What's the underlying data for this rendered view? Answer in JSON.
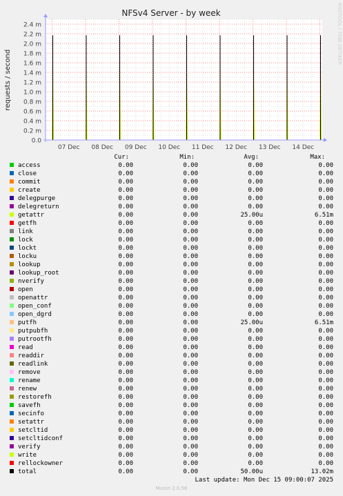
{
  "chart_data": {
    "type": "line",
    "title": "NFSv4 Server - by week",
    "ylabel": "requests / second",
    "xlabel": "",
    "ylim": [
      0,
      2.5
    ],
    "yticks": [
      "0.0",
      "0.2 m",
      "0.4 m",
      "0.6 m",
      "0.8 m",
      "1.0 m",
      "1.2 m",
      "1.4 m",
      "1.6 m",
      "1.8 m",
      "2.0 m",
      "2.2 m",
      "2.4 m"
    ],
    "xticks": [
      "07 Dec",
      "08 Dec",
      "09 Dec",
      "10 Dec",
      "11 Dec",
      "12 Dec",
      "13 Dec",
      "14 Dec"
    ],
    "grid": true,
    "series": [
      {
        "name": "total",
        "x": [
          "07 Dec",
          "08 Dec",
          "09 Dec",
          "10 Dec",
          "11 Dec",
          "12 Dec",
          "13 Dec",
          "14 Dec",
          "15 Dec"
        ],
        "values": [
          2.17,
          2.17,
          2.17,
          2.17,
          2.17,
          2.17,
          2.17,
          2.17,
          2.17
        ]
      }
    ]
  },
  "legend": {
    "headers": {
      "cur": "Cur:",
      "min": "Min:",
      "avg": "Avg:",
      "max": "Max:"
    },
    "rows": [
      {
        "name": "access",
        "color": "#00cc00",
        "cur": "0.00",
        "min": "0.00",
        "avg": "0.00",
        "max": "0.00"
      },
      {
        "name": "close",
        "color": "#0066b3",
        "cur": "0.00",
        "min": "0.00",
        "avg": "0.00",
        "max": "0.00"
      },
      {
        "name": "commit",
        "color": "#ff8000",
        "cur": "0.00",
        "min": "0.00",
        "avg": "0.00",
        "max": "0.00"
      },
      {
        "name": "create",
        "color": "#ffcc00",
        "cur": "0.00",
        "min": "0.00",
        "avg": "0.00",
        "max": "0.00"
      },
      {
        "name": "delegpurge",
        "color": "#330099",
        "cur": "0.00",
        "min": "0.00",
        "avg": "0.00",
        "max": "0.00"
      },
      {
        "name": "delegreturn",
        "color": "#990099",
        "cur": "0.00",
        "min": "0.00",
        "avg": "0.00",
        "max": "0.00"
      },
      {
        "name": "getattr",
        "color": "#ccff00",
        "cur": "0.00",
        "min": "0.00",
        "avg": "25.00u",
        "max": "6.51m"
      },
      {
        "name": "getfh",
        "color": "#ff0000",
        "cur": "0.00",
        "min": "0.00",
        "avg": "0.00",
        "max": "0.00"
      },
      {
        "name": "link",
        "color": "#808080",
        "cur": "0.00",
        "min": "0.00",
        "avg": "0.00",
        "max": "0.00"
      },
      {
        "name": "lock",
        "color": "#008f00",
        "cur": "0.00",
        "min": "0.00",
        "avg": "0.00",
        "max": "0.00"
      },
      {
        "name": "lockt",
        "color": "#00487d",
        "cur": "0.00",
        "min": "0.00",
        "avg": "0.00",
        "max": "0.00"
      },
      {
        "name": "locku",
        "color": "#b35a00",
        "cur": "0.00",
        "min": "0.00",
        "avg": "0.00",
        "max": "0.00"
      },
      {
        "name": "lookup",
        "color": "#b38f00",
        "cur": "0.00",
        "min": "0.00",
        "avg": "0.00",
        "max": "0.00"
      },
      {
        "name": "lookup_root",
        "color": "#6b006b",
        "cur": "0.00",
        "min": "0.00",
        "avg": "0.00",
        "max": "0.00"
      },
      {
        "name": "nverify",
        "color": "#8fb300",
        "cur": "0.00",
        "min": "0.00",
        "avg": "0.00",
        "max": "0.00"
      },
      {
        "name": "open",
        "color": "#b30000",
        "cur": "0.00",
        "min": "0.00",
        "avg": "0.00",
        "max": "0.00"
      },
      {
        "name": "openattr",
        "color": "#bebebe",
        "cur": "0.00",
        "min": "0.00",
        "avg": "0.00",
        "max": "0.00"
      },
      {
        "name": "open_conf",
        "color": "#80ff80",
        "cur": "0.00",
        "min": "0.00",
        "avg": "0.00",
        "max": "0.00"
      },
      {
        "name": "open_dgrd",
        "color": "#80c9ff",
        "cur": "0.00",
        "min": "0.00",
        "avg": "0.00",
        "max": "0.00"
      },
      {
        "name": "putfh",
        "color": "#ffc080",
        "cur": "0.00",
        "min": "0.00",
        "avg": "25.00u",
        "max": "6.51m"
      },
      {
        "name": "putpubfh",
        "color": "#ffe680",
        "cur": "0.00",
        "min": "0.00",
        "avg": "0.00",
        "max": "0.00"
      },
      {
        "name": "putrootfh",
        "color": "#aa80ff",
        "cur": "0.00",
        "min": "0.00",
        "avg": "0.00",
        "max": "0.00"
      },
      {
        "name": "read",
        "color": "#ee00cc",
        "cur": "0.00",
        "min": "0.00",
        "avg": "0.00",
        "max": "0.00"
      },
      {
        "name": "readdir",
        "color": "#ff8080",
        "cur": "0.00",
        "min": "0.00",
        "avg": "0.00",
        "max": "0.00"
      },
      {
        "name": "readlink",
        "color": "#666600",
        "cur": "0.00",
        "min": "0.00",
        "avg": "0.00",
        "max": "0.00"
      },
      {
        "name": "remove",
        "color": "#ffbfff",
        "cur": "0.00",
        "min": "0.00",
        "avg": "0.00",
        "max": "0.00"
      },
      {
        "name": "rename",
        "color": "#00ffcc",
        "cur": "0.00",
        "min": "0.00",
        "avg": "0.00",
        "max": "0.00"
      },
      {
        "name": "renew",
        "color": "#cc6699",
        "cur": "0.00",
        "min": "0.00",
        "avg": "0.00",
        "max": "0.00"
      },
      {
        "name": "restorefh",
        "color": "#999900",
        "cur": "0.00",
        "min": "0.00",
        "avg": "0.00",
        "max": "0.00"
      },
      {
        "name": "savefh",
        "color": "#00cc00",
        "cur": "0.00",
        "min": "0.00",
        "avg": "0.00",
        "max": "0.00"
      },
      {
        "name": "secinfo",
        "color": "#0066b3",
        "cur": "0.00",
        "min": "0.00",
        "avg": "0.00",
        "max": "0.00"
      },
      {
        "name": "setattr",
        "color": "#ff8000",
        "cur": "0.00",
        "min": "0.00",
        "avg": "0.00",
        "max": "0.00"
      },
      {
        "name": "setcltid",
        "color": "#ffcc00",
        "cur": "0.00",
        "min": "0.00",
        "avg": "0.00",
        "max": "0.00"
      },
      {
        "name": "setcltidconf",
        "color": "#330099",
        "cur": "0.00",
        "min": "0.00",
        "avg": "0.00",
        "max": "0.00"
      },
      {
        "name": "verify",
        "color": "#990099",
        "cur": "0.00",
        "min": "0.00",
        "avg": "0.00",
        "max": "0.00"
      },
      {
        "name": "write",
        "color": "#ccff00",
        "cur": "0.00",
        "min": "0.00",
        "avg": "0.00",
        "max": "0.00"
      },
      {
        "name": "rellockowner",
        "color": "#ff0000",
        "cur": "0.00",
        "min": "0.00",
        "avg": "0.00",
        "max": "0.00"
      },
      {
        "name": "total",
        "color": "#000000",
        "cur": "0.00",
        "min": "0.00",
        "avg": "50.00u",
        "max": "13.02m"
      }
    ]
  },
  "footer": {
    "last_update": "Last update: Mon Dec 15 09:00:07 2025",
    "version": "Munin 2.0.56"
  },
  "watermark": "RRDTOOL / TOBI OETIKER",
  "colors": {
    "background": "#f0f0f0",
    "plot_background": "#ffffff",
    "grid_minor": "#e0e0e0",
    "grid_major": "#ff8080",
    "axis": "#9999ff",
    "spike_line": "#000000",
    "spike_fill": "#ccff00"
  }
}
